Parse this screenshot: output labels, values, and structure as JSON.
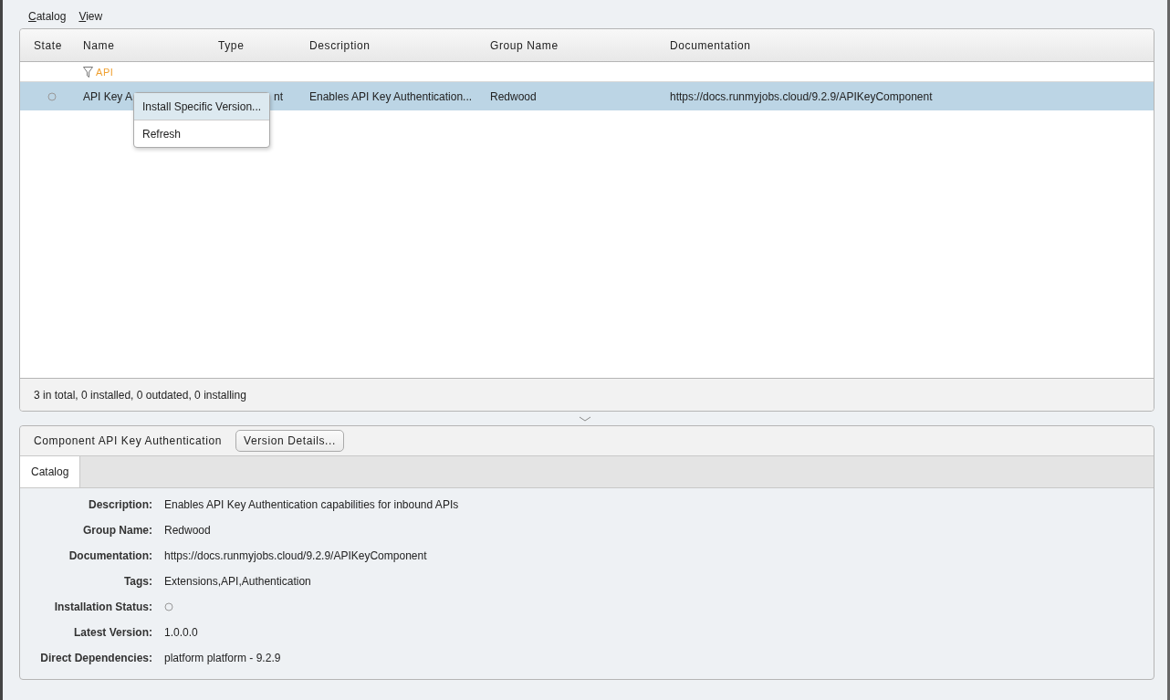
{
  "menu_bar": [
    {
      "label": "Catalog"
    },
    {
      "label": "View"
    }
  ],
  "table": {
    "columns": [
      "State",
      "Name",
      "Type",
      "Description",
      "Group Name",
      "Documentation"
    ],
    "filter": {
      "text": "API"
    },
    "rows": [
      {
        "installed": false,
        "name": "API Key A",
        "type": "nt",
        "description": "Enables API Key Authentication...",
        "group_name": "Redwood",
        "documentation": "https://docs.runmyjobs.cloud/9.2.9/APIKeyComponent",
        "selected": true
      }
    ],
    "status": "3 in total, 0 installed, 0 outdated, 0 installing"
  },
  "context_menu": [
    {
      "label": "Install Specific Version...",
      "selected": true
    },
    {
      "label": "Refresh",
      "selected": false
    }
  ],
  "detail": {
    "title": "Component API Key Authentication",
    "button": "Version Details...",
    "tabs": [
      {
        "label": "Catalog",
        "selected": true
      }
    ],
    "properties": [
      {
        "label": "Description:",
        "kind": "text",
        "value": "Enables API Key Authentication capabilities for inbound APIs"
      },
      {
        "label": "Group Name:",
        "kind": "text",
        "value": "Redwood"
      },
      {
        "label": "Documentation:",
        "kind": "text",
        "value": "https://docs.runmyjobs.cloud/9.2.9/APIKeyComponent"
      },
      {
        "label": "Tags:",
        "kind": "text",
        "value": "Extensions,API,Authentication"
      },
      {
        "label": "Installation Status:",
        "kind": "state",
        "installed": false
      },
      {
        "label": "Latest Version:",
        "kind": "text",
        "value": "1.0.0.0"
      },
      {
        "label": "Direct Dependencies:",
        "kind": "text",
        "value": "platform platform - 9.2.9"
      }
    ]
  }
}
